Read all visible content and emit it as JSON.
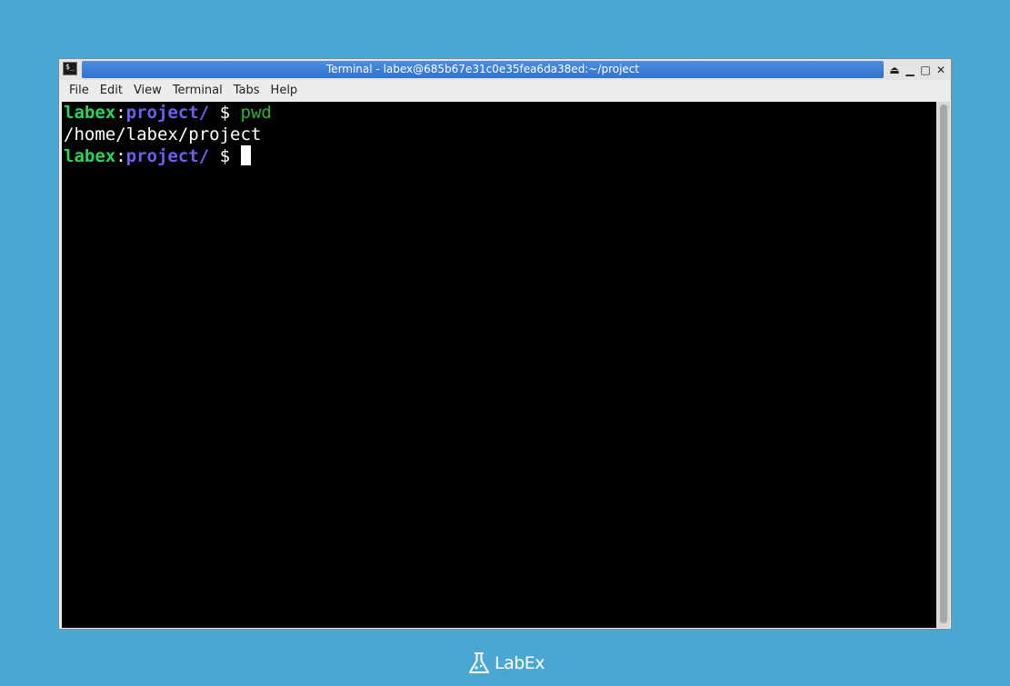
{
  "window": {
    "title": "Terminal - labex@685b67e31c0e35fea6da38ed:~/project",
    "controls": {
      "shade": "⏏",
      "minimize": "▁",
      "maximize": "□",
      "close": "✕"
    }
  },
  "menubar": {
    "items": [
      "File",
      "Edit",
      "View",
      "Terminal",
      "Tabs",
      "Help"
    ]
  },
  "terminal": {
    "lines": [
      {
        "user": "labex",
        "colon": ":",
        "path": "project/",
        "prompt": " $ ",
        "command": "pwd"
      },
      {
        "output": "/home/labex/project"
      },
      {
        "user": "labex",
        "colon": ":",
        "path": "project/",
        "prompt": " $ ",
        "command": ""
      }
    ]
  },
  "branding": {
    "logo_text": "LabEx"
  },
  "colors": {
    "desktop": "#4aa7d1",
    "title_bar": "#2f72cd",
    "prompt_user": "#2bd45a",
    "prompt_path": "#6d5ff0",
    "command": "#2bb23a"
  }
}
